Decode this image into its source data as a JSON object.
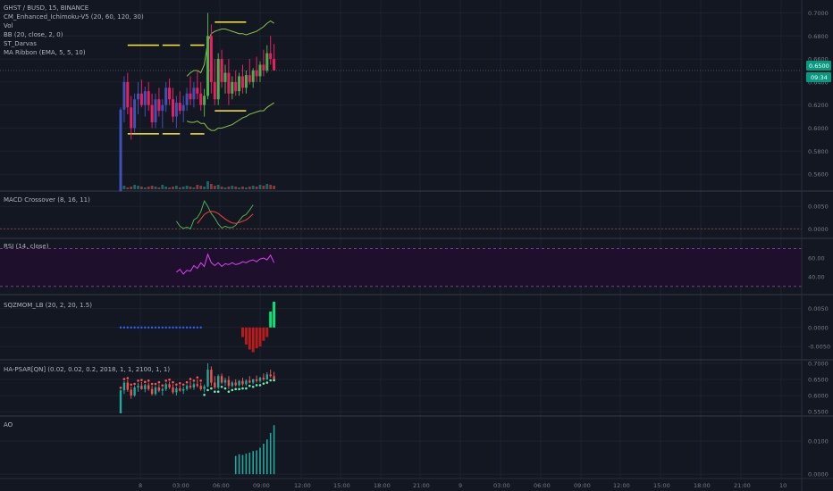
{
  "header": {
    "symbol": "GHST / BUSD, 15, BINANCE",
    "indicators": [
      "CM_Enhanced_Ichimoku-V5 (20, 60, 120, 30)",
      "Vol",
      "BB (20, close, 2, 0)",
      "ST_Darvas",
      "MA Ribbon (EMA, 5, 5, 10)"
    ]
  },
  "price_tag": {
    "value": "0.6500",
    "countdown": "09:34",
    "color": "#089981"
  },
  "colors": {
    "background": "#131722",
    "up": "#26a69a",
    "down": "#ef5350",
    "candle_up": "#4caf50",
    "candle_down": "#e91e63",
    "hollow_candle": "#3f51b5",
    "darvas": "#ffeb3b",
    "bb": "#8bc34a",
    "macd": "#4caf50",
    "signal": "#f44336",
    "rsi": "#e040fb",
    "rsi_band": "#1e0f2c"
  },
  "panels": [
    {
      "id": "price",
      "label": "",
      "ticks": [
        "0.7000",
        "0.6800",
        "0.6600",
        "0.6400",
        "0.6200",
        "0.6000",
        "0.5800",
        "0.5600"
      ]
    },
    {
      "id": "macd",
      "label": "MACD Crossover (8, 16, 11)",
      "ticks": [
        "0.0050",
        "0.0000"
      ]
    },
    {
      "id": "rsi",
      "label": "RSI (14, close)",
      "ticks": [
        "60.00",
        "40.00"
      ]
    },
    {
      "id": "sqz",
      "label": "SQZMOM_LB (20, 2, 20, 1.5)",
      "ticks": [
        "0.0050",
        "0.0000",
        "-0.0050"
      ]
    },
    {
      "id": "psar",
      "label": "HA-PSAR[QN] (0.02, 0.02, 0.2, 2018, 1, 1, 2100, 1, 1)",
      "ticks": [
        "0.7000",
        "0.6500",
        "0.6000",
        "0.5500"
      ]
    },
    {
      "id": "ao",
      "label": "AO",
      "ticks": [
        "0.0100",
        "0.0000"
      ]
    }
  ],
  "time_axis": [
    "8",
    "03:00",
    "06:00",
    "09:00",
    "12:00",
    "15:00",
    "18:00",
    "21:00",
    "9",
    "03:00",
    "06:00",
    "09:00",
    "12:00",
    "15:00",
    "18:00",
    "21:00",
    "10"
  ],
  "chart_data": {
    "type": "candlestick",
    "price": {
      "ylim": [
        0.55,
        0.705
      ],
      "candles": [
        [
          0.545,
          0.618,
          0.545,
          0.616
        ],
        [
          0.616,
          0.645,
          0.605,
          0.64
        ],
        [
          0.64,
          0.648,
          0.612,
          0.618
        ],
        [
          0.618,
          0.628,
          0.59,
          0.6
        ],
        [
          0.6,
          0.63,
          0.596,
          0.625
        ],
        [
          0.625,
          0.64,
          0.612,
          0.63
        ],
        [
          0.63,
          0.642,
          0.618,
          0.62
        ],
        [
          0.62,
          0.636,
          0.61,
          0.632
        ],
        [
          0.632,
          0.64,
          0.615,
          0.62
        ],
        [
          0.62,
          0.63,
          0.6,
          0.605
        ],
        [
          0.605,
          0.63,
          0.6,
          0.625
        ],
        [
          0.625,
          0.635,
          0.61,
          0.615
        ],
        [
          0.615,
          0.625,
          0.6,
          0.62
        ],
        [
          0.62,
          0.64,
          0.614,
          0.635
        ],
        [
          0.635,
          0.643,
          0.62,
          0.625
        ],
        [
          0.625,
          0.635,
          0.605,
          0.61
        ],
        [
          0.61,
          0.628,
          0.6,
          0.622
        ],
        [
          0.622,
          0.632,
          0.612,
          0.615
        ],
        [
          0.615,
          0.628,
          0.605,
          0.62
        ],
        [
          0.62,
          0.635,
          0.615,
          0.63
        ],
        [
          0.63,
          0.645,
          0.62,
          0.625
        ],
        [
          0.625,
          0.64,
          0.618,
          0.635
        ],
        [
          0.635,
          0.65,
          0.625,
          0.63
        ],
        [
          0.63,
          0.64,
          0.615,
          0.62
        ],
        [
          0.62,
          0.634,
          0.61,
          0.628
        ],
        [
          0.628,
          0.7,
          0.625,
          0.68
        ],
        [
          0.68,
          0.69,
          0.63,
          0.64
        ],
        [
          0.64,
          0.66,
          0.62,
          0.625
        ],
        [
          0.625,
          0.665,
          0.62,
          0.66
        ],
        [
          0.66,
          0.668,
          0.635,
          0.64
        ],
        [
          0.64,
          0.655,
          0.63,
          0.648
        ],
        [
          0.648,
          0.66,
          0.62,
          0.63
        ],
        [
          0.63,
          0.645,
          0.625,
          0.64
        ],
        [
          0.64,
          0.65,
          0.628,
          0.632
        ],
        [
          0.632,
          0.648,
          0.628,
          0.645
        ],
        [
          0.645,
          0.655,
          0.63,
          0.635
        ],
        [
          0.635,
          0.65,
          0.63,
          0.646
        ],
        [
          0.646,
          0.66,
          0.638,
          0.64
        ],
        [
          0.64,
          0.652,
          0.635,
          0.65
        ],
        [
          0.65,
          0.662,
          0.64,
          0.645
        ],
        [
          0.645,
          0.658,
          0.64,
          0.655
        ],
        [
          0.655,
          0.668,
          0.645,
          0.65
        ],
        [
          0.65,
          0.672,
          0.648,
          0.665
        ],
        [
          0.665,
          0.68,
          0.655,
          0.66
        ],
        [
          0.66,
          0.673,
          0.655,
          0.65
        ]
      ],
      "volume": [
        3,
        4,
        2,
        3,
        5,
        4,
        3,
        2,
        3,
        4,
        3,
        2,
        5,
        3,
        2,
        3,
        4,
        2,
        3,
        4,
        3,
        2,
        5,
        4,
        3,
        9,
        6,
        4,
        5,
        3,
        2,
        3,
        4,
        3,
        2,
        3,
        2,
        3,
        4,
        3,
        5,
        4,
        6,
        5,
        4
      ],
      "bb_upper": [
        null,
        null,
        null,
        null,
        null,
        null,
        null,
        null,
        null,
        null,
        null,
        null,
        null,
        null,
        null,
        null,
        null,
        null,
        null,
        0.645,
        0.648,
        0.65,
        0.65,
        0.648,
        0.655,
        0.675,
        0.682,
        0.684,
        0.685,
        0.686,
        0.686,
        0.685,
        0.684,
        0.683,
        0.682,
        0.682,
        0.681,
        0.682,
        0.683,
        0.684,
        0.686,
        0.688,
        0.691,
        0.693,
        0.691
      ],
      "bb_lower": [
        null,
        null,
        null,
        null,
        null,
        null,
        null,
        null,
        null,
        null,
        null,
        null,
        null,
        null,
        null,
        null,
        null,
        null,
        null,
        0.606,
        0.605,
        0.605,
        0.606,
        0.604,
        0.604,
        0.6,
        0.598,
        0.598,
        0.6,
        0.6,
        0.601,
        0.602,
        0.603,
        0.605,
        0.607,
        0.609,
        0.61,
        0.612,
        0.613,
        0.614,
        0.615,
        0.615,
        0.618,
        0.62,
        0.622
      ],
      "darvas_boxes": [
        [
          2,
          11,
          0.672,
          0.595
        ],
        [
          12,
          17,
          0.672,
          0.595
        ],
        [
          20,
          24,
          0.672,
          0.595
        ],
        [
          27,
          36,
          0.692,
          0.615
        ]
      ]
    },
    "macd": {
      "ylim": [
        -0.0015,
        0.0072
      ],
      "macd": [
        null,
        null,
        null,
        null,
        null,
        null,
        null,
        null,
        null,
        null,
        null,
        null,
        null,
        null,
        null,
        null,
        0.0017,
        0.0006,
        0.0001,
        0.0004,
        0.0,
        0.002,
        0.0025,
        0.0038,
        0.0062,
        0.005,
        0.0034,
        0.0024,
        0.0011,
        0.0002,
        0.0006,
        0.0003,
        0.0003,
        0.0008,
        0.0018,
        0.0028,
        0.0032,
        0.0042,
        0.0053
      ],
      "signal": [
        null,
        null,
        null,
        null,
        null,
        null,
        null,
        null,
        null,
        null,
        null,
        null,
        null,
        null,
        null,
        null,
        null,
        null,
        null,
        null,
        null,
        null,
        0.0012,
        0.0022,
        0.0032,
        0.0037,
        0.0039,
        0.0038,
        0.0034,
        0.0028,
        0.0022,
        0.0017,
        0.0013,
        0.0012,
        0.0014,
        0.0017,
        0.002,
        0.0026,
        0.0033
      ]
    },
    "rsi": {
      "ylim": [
        25,
        78
      ],
      "values": [
        null,
        null,
        null,
        null,
        null,
        null,
        null,
        null,
        null,
        null,
        null,
        null,
        null,
        null,
        null,
        null,
        45,
        48,
        43,
        47,
        46,
        52,
        49,
        55,
        51,
        64,
        55,
        52,
        55,
        51,
        54,
        53,
        55,
        53,
        54,
        56,
        55,
        57,
        58,
        56,
        59,
        60,
        58,
        63,
        55
      ]
    },
    "sqzmom": {
      "ylim": [
        -0.0078,
        0.0075
      ],
      "zero_dots": 24,
      "values": [
        null,
        null,
        null,
        null,
        null,
        null,
        null,
        null,
        null,
        null,
        null,
        null,
        null,
        null,
        null,
        null,
        null,
        null,
        null,
        null,
        null,
        null,
        null,
        null,
        null,
        null,
        null,
        null,
        null,
        null,
        null,
        null,
        null,
        null,
        null,
        -0.0025,
        -0.0045,
        -0.0058,
        -0.0065,
        -0.0055,
        -0.005,
        -0.0035,
        -0.0025,
        0.0042,
        0.0068
      ]
    },
    "ao": {
      "ylim": [
        -0.0005,
        0.0165
      ],
      "values": [
        null,
        null,
        null,
        null,
        null,
        null,
        null,
        null,
        null,
        null,
        null,
        null,
        null,
        null,
        null,
        null,
        null,
        null,
        null,
        null,
        null,
        null,
        null,
        null,
        null,
        null,
        null,
        null,
        null,
        null,
        null,
        null,
        null,
        0.0055,
        0.006,
        0.0058,
        0.0062,
        0.0065,
        0.007,
        0.0072,
        0.008,
        0.0092,
        0.0105,
        0.0125,
        0.0148
      ]
    }
  }
}
